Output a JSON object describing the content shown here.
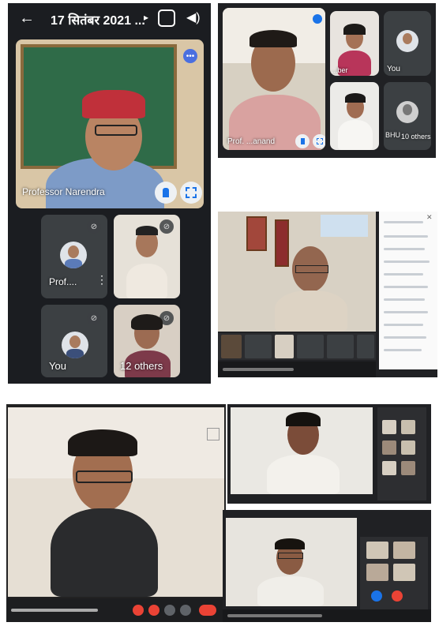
{
  "phone_screen": {
    "title": "17 सितंबर 2021 ...",
    "main_speaker": "Professor Narendra",
    "tiles": [
      {
        "name": "Prof...."
      },
      {
        "name": ""
      },
      {
        "name": "You"
      },
      {
        "name": "12 others"
      }
    ]
  },
  "top_right_call": {
    "main_speaker": "Prof. ...anand",
    "tiles": [
      {
        "name": "...ber"
      },
      {
        "name": "You"
      },
      {
        "name": ""
      },
      {
        "name": "BHU"
      },
      {
        "name": "10 others"
      }
    ]
  },
  "colors": {
    "dark_bg": "#1b1d21",
    "tile_bg": "#3c4043",
    "accent_blue": "#1a73e8",
    "red_cap": "#c0303a",
    "classroom_green": "#2f6b48"
  },
  "icons": [
    "back-arrow-icon",
    "switch-camera-icon",
    "speaker-icon",
    "more-options-icon",
    "pin-icon",
    "fullscreen-icon",
    "mic-off-icon",
    "audio-activity-icon"
  ]
}
